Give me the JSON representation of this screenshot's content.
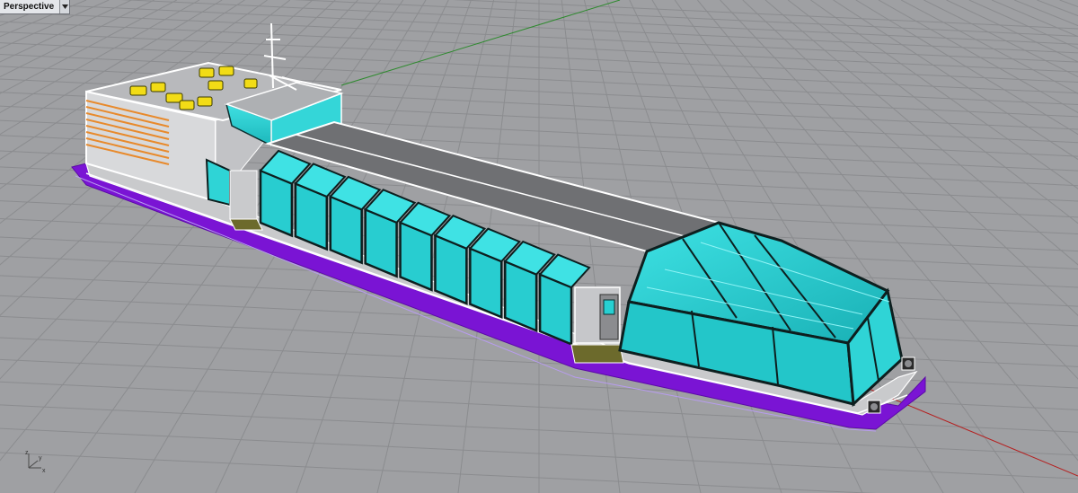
{
  "viewport": {
    "label": "Perspective",
    "menu_icon": "chevron-down-icon"
  },
  "axes": {
    "z_label": "z",
    "y_label": "y",
    "x_label": "x"
  },
  "colors": {
    "background": "#9fa0a3",
    "grid_line": "#8b8c8f",
    "glass": "#27d0d2",
    "hull_stripe": "#7a14d4",
    "roof": "#6f7073",
    "deck_furniture": "#f2dc16",
    "vent_grille": "#e88a2c",
    "x_axis": "#b52020",
    "y_axis": "#2e8a2e"
  }
}
